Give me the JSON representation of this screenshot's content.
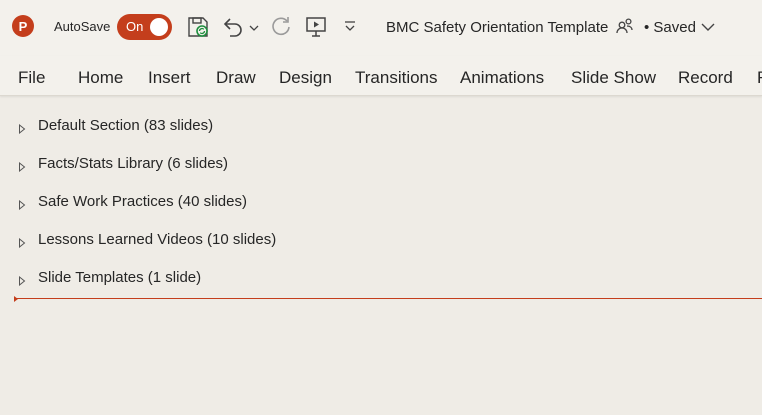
{
  "titlebar": {
    "app_icon": "powerpoint-logo-icon",
    "app_letter": "P",
    "autosave_label": "AutoSave",
    "autosave_state": "On",
    "document_title": "BMC Safety Orientation Template",
    "save_status": "• Saved",
    "accent_color": "#c43e1c"
  },
  "ribbon": {
    "tabs": [
      "File",
      "Home",
      "Insert",
      "Draw",
      "Design",
      "Transitions",
      "Animations",
      "Slide Show",
      "Record",
      "R"
    ]
  },
  "sections": [
    {
      "label": "Default Section (83 slides)"
    },
    {
      "label": "Facts/Stats Library (6 slides)"
    },
    {
      "label": "Safe Work Practices (40 slides)"
    },
    {
      "label": "Lessons Learned Videos (10 slides)"
    },
    {
      "label": "Slide Templates (1 slide)"
    }
  ]
}
